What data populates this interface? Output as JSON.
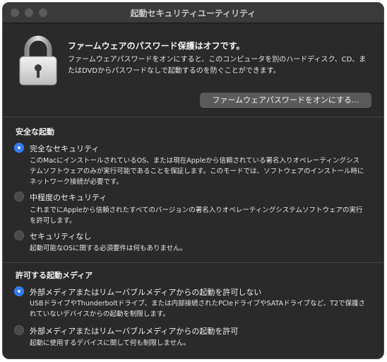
{
  "window": {
    "title": "起動セキュリティユーティリティ"
  },
  "firmware": {
    "headline": "ファームウェアのパスワード保護はオフです。",
    "description": "ファームウェアパスワードをオンにすると、このコンピュータを別のハードディスク、CD、またはDVDからパスワードなしで起動するのを防ぐことができます。",
    "button_label": "ファームウェアパスワードをオンにする..."
  },
  "secure_boot": {
    "heading": "安全な起動",
    "options": [
      {
        "label": "完全なセキュリティ",
        "selected": true,
        "description": "このMacにインストールされているOS、または現在Appleから信頼されている署名入りオペレーティングシステムソフトウェアのみが実行可能であることを保証します。このモードでは、ソフトウェアのインストール時にネットワーク接続が必要です。"
      },
      {
        "label": "中程度のセキュリティ",
        "selected": false,
        "description": "これまでにAppleから信頼されたすべてのバージョンの署名入りオペレーティングシステムソフトウェアの実行を許可します。"
      },
      {
        "label": "セキュリティなし",
        "selected": false,
        "description": "起動可能なOSに関する必須要件は何もありません。"
      }
    ]
  },
  "boot_media": {
    "heading": "許可する起動メディア",
    "options": [
      {
        "label": "外部メディアまたはリムーバブルメディアからの起動を許可しない",
        "selected": true,
        "description": "USBドライブやThunderboltドライブ、または内部接続されたPCIeドライブやSATAドライブなど、T2で保護されていないデバイスからの起動を制限します。"
      },
      {
        "label": "外部メディアまたはリムーバブルメディアからの起動を許可",
        "selected": false,
        "description": "起動に使用するデバイスに関して何も制限しません。"
      }
    ]
  },
  "colors": {
    "accent": "#2f7bf5",
    "window_bg": "#2a2a2a"
  },
  "icons": {
    "lock": "lock-icon"
  }
}
